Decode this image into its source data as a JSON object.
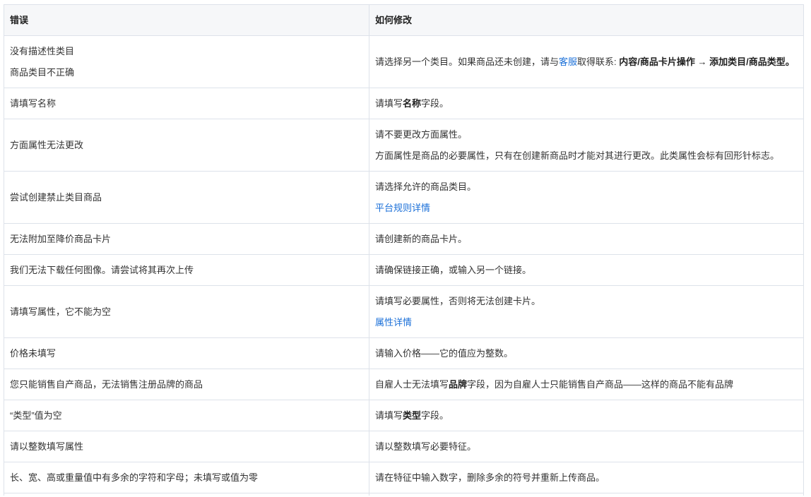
{
  "colors": {
    "page_background": "#ffffff",
    "border": "#dde2ea",
    "header_background": "#f6f7f9",
    "text": "#333333",
    "emphasis_text": "#1f1f1f",
    "link": "#1a6fd8"
  },
  "table": {
    "header": {
      "error": "错误",
      "fix": "如何修改"
    },
    "rows": [
      {
        "error": [
          "没有描述性类目",
          "商品类目不正确"
        ],
        "fix": [
          [
            {
              "text": "请选择另一个类目。如果商品还未创建，请与"
            },
            {
              "text": "客服",
              "link": true
            },
            {
              "text": "取得联系: "
            },
            {
              "text": "内容/商品卡片操作 → 添加类目/商品类型。",
              "bold": true
            }
          ]
        ]
      },
      {
        "error": [
          "请填写名称"
        ],
        "fix": [
          [
            {
              "text": "请填写"
            },
            {
              "text": "名称",
              "bold": true
            },
            {
              "text": "字段。"
            }
          ]
        ]
      },
      {
        "error": [
          "方面属性无法更改"
        ],
        "fix": [
          [
            {
              "text": "请不要更改方面属性。"
            }
          ],
          [
            {
              "text": "方面属性是商品的必要属性，只有在创建新商品时才能对其进行更改。此类属性会标有回形针标志。"
            }
          ]
        ]
      },
      {
        "error": [
          "尝试创建禁止类目商品"
        ],
        "fix": [
          [
            {
              "text": "请选择允许的商品类目。"
            }
          ],
          [
            {
              "text": "平台规则详情",
              "link": true
            }
          ]
        ]
      },
      {
        "error": [
          "无法附加至降价商品卡片"
        ],
        "fix": [
          [
            {
              "text": "请创建新的商品卡片。"
            }
          ]
        ]
      },
      {
        "error": [
          "我们无法下载任何图像。请尝试将其再次上传"
        ],
        "fix": [
          [
            {
              "text": "请确保链接正确，或输入另一个链接。"
            }
          ]
        ]
      },
      {
        "error": [
          "请填写属性，它不能为空"
        ],
        "fix": [
          [
            {
              "text": "请填写必要属性，否则将无法创建卡片。"
            }
          ],
          [
            {
              "text": "属性详情",
              "link": true
            }
          ]
        ]
      },
      {
        "error": [
          "价格未填写"
        ],
        "fix": [
          [
            {
              "text": "请输入价格——它的值应为整数。"
            }
          ]
        ]
      },
      {
        "error": [
          "您只能销售自产商品，无法销售注册品牌的商品"
        ],
        "fix": [
          [
            {
              "text": "自雇人士无法填写"
            },
            {
              "text": "品牌",
              "bold": true
            },
            {
              "text": "字段，因为自雇人士只能销售自产商品——这样的商品不能有品牌"
            }
          ]
        ]
      },
      {
        "error": [
          "“类型”值为空"
        ],
        "fix": [
          [
            {
              "text": "请填写"
            },
            {
              "text": "类型",
              "bold": true
            },
            {
              "text": "字段。"
            }
          ]
        ]
      },
      {
        "error": [
          "请以整数填写属性"
        ],
        "fix": [
          [
            {
              "text": "请以整数填写必要特征。"
            }
          ]
        ]
      },
      {
        "error": [
          "长、宽、高或重量值中有多余的字符和字母；未填写或值为零"
        ],
        "fix": [
          [
            {
              "text": "请在特征中输入数字，删除多余的符号并重新上传商品。"
            }
          ]
        ]
      }
    ]
  }
}
